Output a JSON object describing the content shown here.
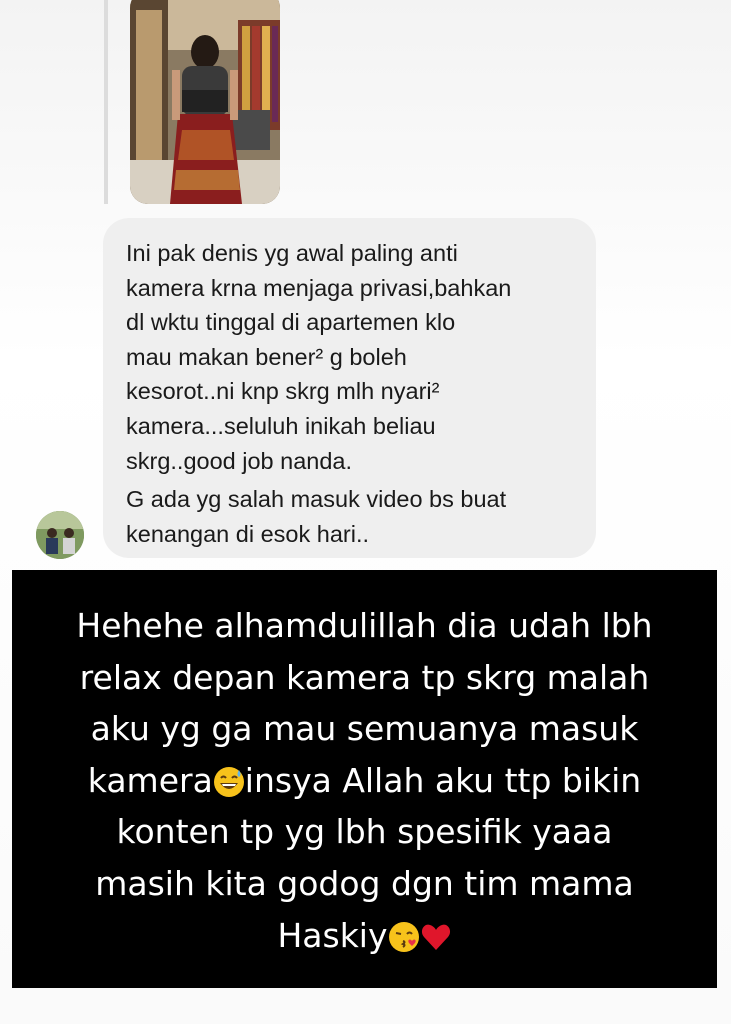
{
  "comment": {
    "text_part1": "Ini pak denis yg awal paling anti\nkamera krna menjaga privasi,bahkan\ndl wktu tinggal di apartemen klo\nmau makan bener² g boleh\nkesorot..ni knp skrg mlh nyari²\nkamera...seluluh inikah beliau\nskrg..good job nanda.",
    "text_part2": "G ada yg salah masuk video bs buat\nkenangan di esok hari.."
  },
  "caption": {
    "line_a": "Hehehe alhamdulillah dia udah lbh\nrelax depan kamera tp skrg malah\naku yg ga mau semuanya masuk\nkamera",
    "line_b": "insya Allah aku ttp bikin\nkonten tp yg lbh spesifik yaaa\nmasih kita godog dgn tim mama\nHaskiy",
    "emojis": [
      "grinning-sweat-emoji",
      "kissing-heart-emoji",
      "red-heart-emoji"
    ]
  },
  "colors": {
    "bubble_bg": "#efefef",
    "caption_bg": "#000000",
    "caption_text": "#ffffff"
  }
}
